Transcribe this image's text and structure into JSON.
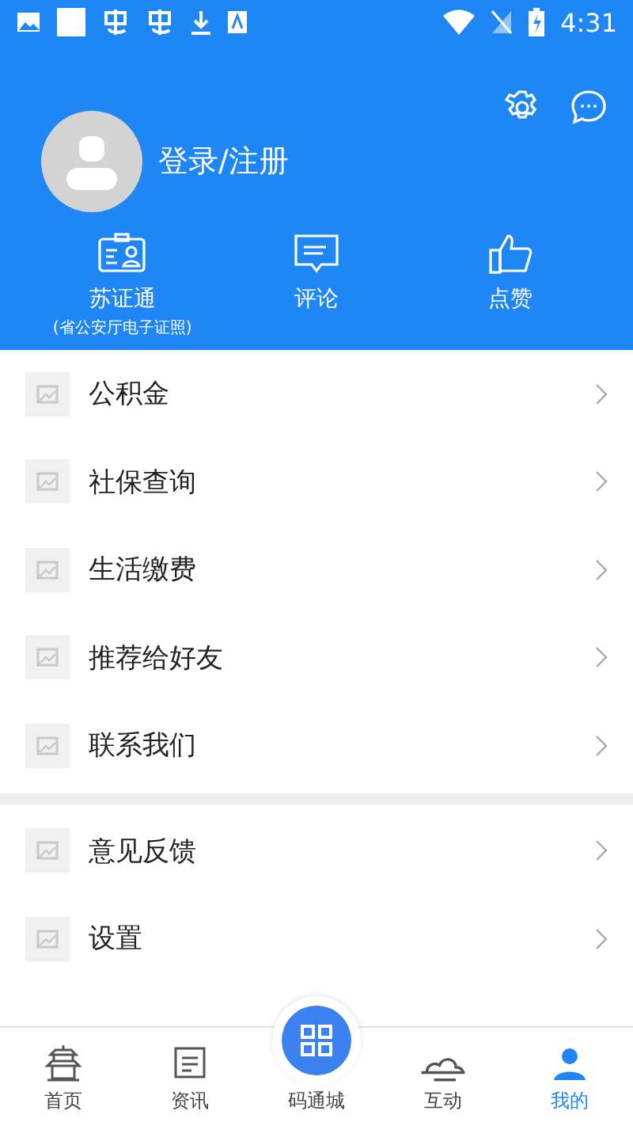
{
  "status_bar": {
    "time": "4:31"
  },
  "profile": {
    "login_label": "登录/注册"
  },
  "quick_actions": [
    {
      "kind": "id-card",
      "label": "苏证通",
      "sublabel": "(省公安厅电子证照)"
    },
    {
      "kind": "comment",
      "label": "评论"
    },
    {
      "kind": "like",
      "label": "点赞"
    }
  ],
  "menu_groups": [
    [
      {
        "label": "公积金"
      },
      {
        "label": "社保查询"
      },
      {
        "label": "生活缴费"
      },
      {
        "label": "推荐给好友"
      },
      {
        "label": "联系我们"
      }
    ],
    [
      {
        "label": "意见反馈"
      },
      {
        "label": "设置"
      }
    ]
  ],
  "bottom_nav": [
    {
      "kind": "home",
      "label": "首页",
      "selected": false
    },
    {
      "kind": "news",
      "label": "资讯",
      "selected": false
    },
    {
      "kind": "center",
      "label": "码通城",
      "selected": false
    },
    {
      "kind": "interact",
      "label": "互动",
      "selected": false
    },
    {
      "kind": "mine",
      "label": "我的",
      "selected": true
    }
  ]
}
